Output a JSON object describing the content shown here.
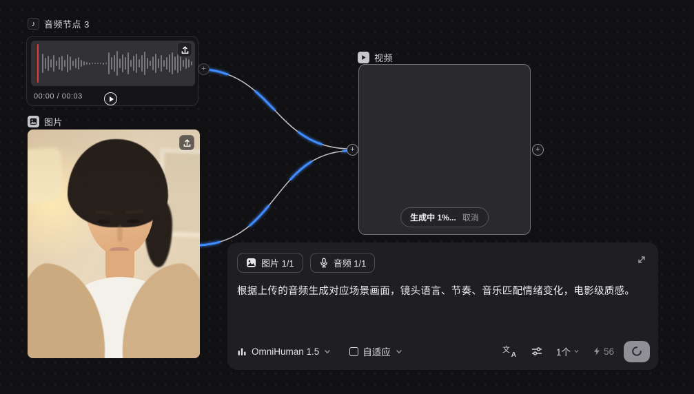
{
  "colors": {
    "bg": "#111113",
    "dot": "#27272a",
    "accent": "#3f8cff",
    "red": "#e03c3c"
  },
  "audio_node": {
    "title": "音频节点 3",
    "icon": "music-note-icon",
    "time": "00:00 / 00:03",
    "waveform": [
      28,
      16,
      22,
      12,
      24,
      8,
      18,
      22,
      10,
      26,
      20,
      8,
      14,
      18,
      10,
      6,
      4,
      3,
      2,
      2,
      2,
      2,
      3,
      2,
      32,
      18,
      24,
      36,
      14,
      26,
      18,
      32,
      10,
      22,
      28,
      12,
      24,
      34,
      16,
      8,
      20,
      28,
      14,
      24,
      10,
      18,
      26,
      32,
      20,
      28,
      22,
      10,
      16,
      12,
      6
    ]
  },
  "image_node": {
    "title": "图片",
    "icon": "image-icon"
  },
  "video_node": {
    "title": "视频",
    "icon": "video-play-icon",
    "status": "生成中 1%...",
    "cancel": "取消"
  },
  "prompt_panel": {
    "tags": [
      {
        "icon": "image-icon",
        "label": "图片 1/1"
      },
      {
        "icon": "mic-icon",
        "label": "音频 1/1"
      }
    ],
    "prompt": "根据上传的音频生成对应场景画面，镜头语言、节奏、音乐匹配情绪变化，电影级质感。",
    "toolbar": {
      "model_icon": "bar-levels-icon",
      "model": "OmniHuman 1.5",
      "aspect_icon": "frame-icon",
      "aspect": "自适应",
      "translate_icon": "translate-icon",
      "settings_icon": "sliders-icon",
      "count": "1个",
      "bolt_icon": "lightning-icon",
      "credits": "56",
      "generate_icon": "spinner-icon"
    }
  },
  "icons": {
    "port": "+",
    "music_note": "♪",
    "translate_zh": "文",
    "translate_en": "A"
  }
}
